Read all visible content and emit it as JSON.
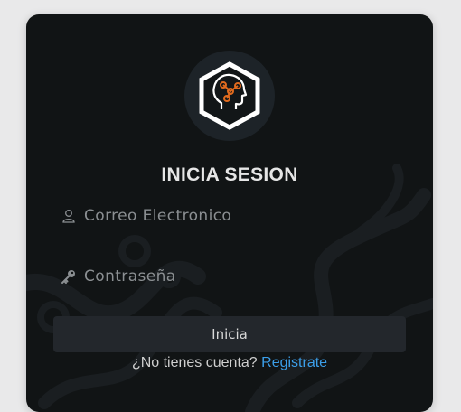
{
  "login": {
    "title": "INICIA SESION",
    "email_placeholder": "Correo Electronico",
    "password_placeholder": "Contraseña",
    "submit_label": "Inicia",
    "signup_prompt": "¿No tienes cuenta?",
    "signup_link": "Registrate"
  },
  "colors": {
    "card_background": "#111415",
    "button_background": "#23272c",
    "link": "#3b9ee8",
    "logo_accent": "#e06a1e"
  },
  "icons": {
    "logo": "head-network-hexagon-icon",
    "email_field": "user-icon",
    "password_field": "key-icon"
  }
}
